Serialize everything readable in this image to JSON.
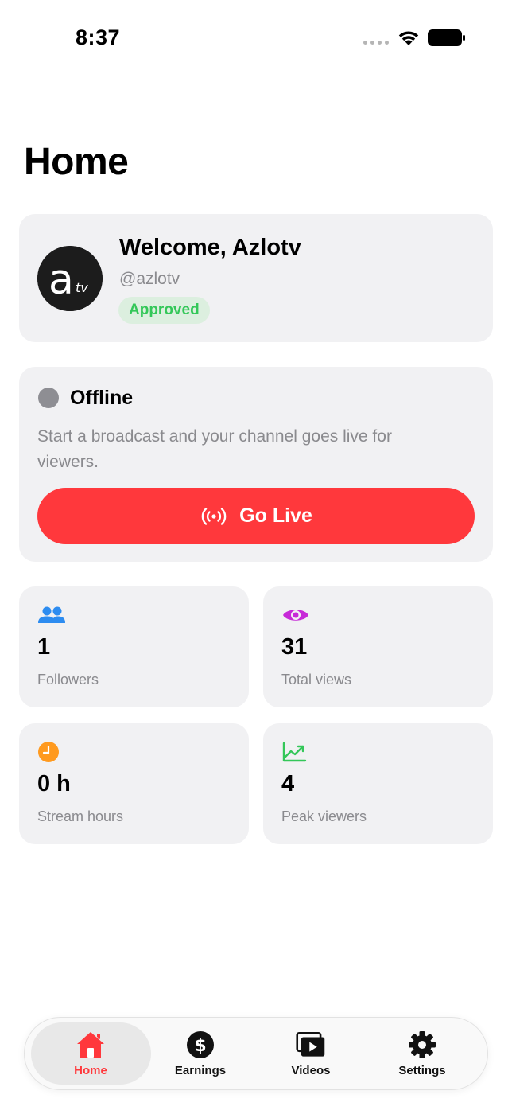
{
  "status_bar": {
    "time": "8:37",
    "icons": [
      "signal-dots-icon",
      "wifi-icon",
      "battery-icon"
    ]
  },
  "page": {
    "title": "Home"
  },
  "profile": {
    "welcome": "Welcome, Azlotv",
    "handle": "@azlotv",
    "status_badge": "Approved",
    "avatar_logo_text": "atv"
  },
  "live": {
    "status": "Offline",
    "description": "Start a broadcast and your channel goes live for viewers.",
    "button_label": "Go Live",
    "button_icon": "broadcast-icon"
  },
  "stats": [
    {
      "value": "1",
      "label": "Followers",
      "icon": "people-icon",
      "color": "#2d8cf0"
    },
    {
      "value": "31",
      "label": "Total views",
      "icon": "eye-icon",
      "color": "#c72ad8"
    },
    {
      "value": "0 h",
      "label": "Stream hours",
      "icon": "clock-icon",
      "color": "#ff9a1f"
    },
    {
      "value": "4",
      "label": "Peak viewers",
      "icon": "trending-up-icon",
      "color": "#34c759"
    }
  ],
  "tabs": [
    {
      "label": "Home",
      "icon": "home-icon",
      "active": true
    },
    {
      "label": "Earnings",
      "icon": "dollar-icon",
      "active": false
    },
    {
      "label": "Videos",
      "icon": "videos-icon",
      "active": false
    },
    {
      "label": "Settings",
      "icon": "gear-icon",
      "active": false
    }
  ],
  "colors": {
    "accent_red": "#ff383c",
    "card_bg": "#f1f1f3",
    "approved_green": "#34c759",
    "offline_gray": "#8e8e93"
  }
}
